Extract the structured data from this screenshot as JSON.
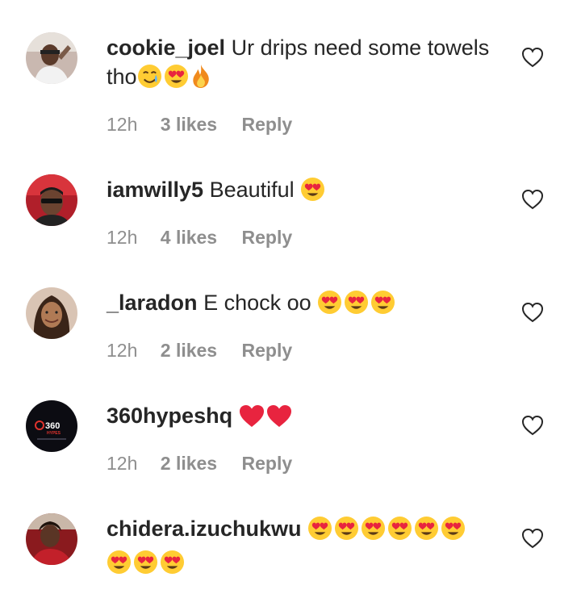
{
  "comments": [
    {
      "username": "cookie_joel",
      "text": "Ur drips need some towels tho",
      "emoji": [
        "tear-smile-emoji",
        "heart-eyes-emoji",
        "fire-emoji"
      ],
      "time": "12h",
      "likes": "3 likes",
      "reply": "Reply"
    },
    {
      "username": "iamwilly5",
      "text": "Beautiful",
      "emoji": [
        "heart-eyes-emoji"
      ],
      "time": "12h",
      "likes": "4 likes",
      "reply": "Reply"
    },
    {
      "username": "_laradon",
      "text": "E chock oo",
      "emoji": [
        "heart-eyes-emoji",
        "heart-eyes-emoji",
        "heart-eyes-emoji"
      ],
      "time": "12h",
      "likes": "2 likes",
      "reply": "Reply"
    },
    {
      "username": "360hypeshq",
      "text": "",
      "emoji": [
        "red-heart-emoji",
        "red-heart-emoji"
      ],
      "time": "12h",
      "likes": "2 likes",
      "reply": "Reply"
    },
    {
      "username": "chidera.izuchukwu",
      "text": "",
      "emoji": [
        "heart-eyes-emoji",
        "heart-eyes-emoji",
        "heart-eyes-emoji",
        "heart-eyes-emoji",
        "heart-eyes-emoji",
        "heart-eyes-emoji",
        "heart-eyes-emoji",
        "heart-eyes-emoji",
        "heart-eyes-emoji"
      ]
    }
  ],
  "avatars": {
    "360hypeshq_logo": "360",
    "360hypeshq_logo_sub": "HYPES"
  },
  "colors": {
    "username": "#262626",
    "meta": "#8e8e8e",
    "heart_outline": "#262626",
    "emoji_face": "#ffcc33",
    "emoji_heart": "#e8243f"
  }
}
